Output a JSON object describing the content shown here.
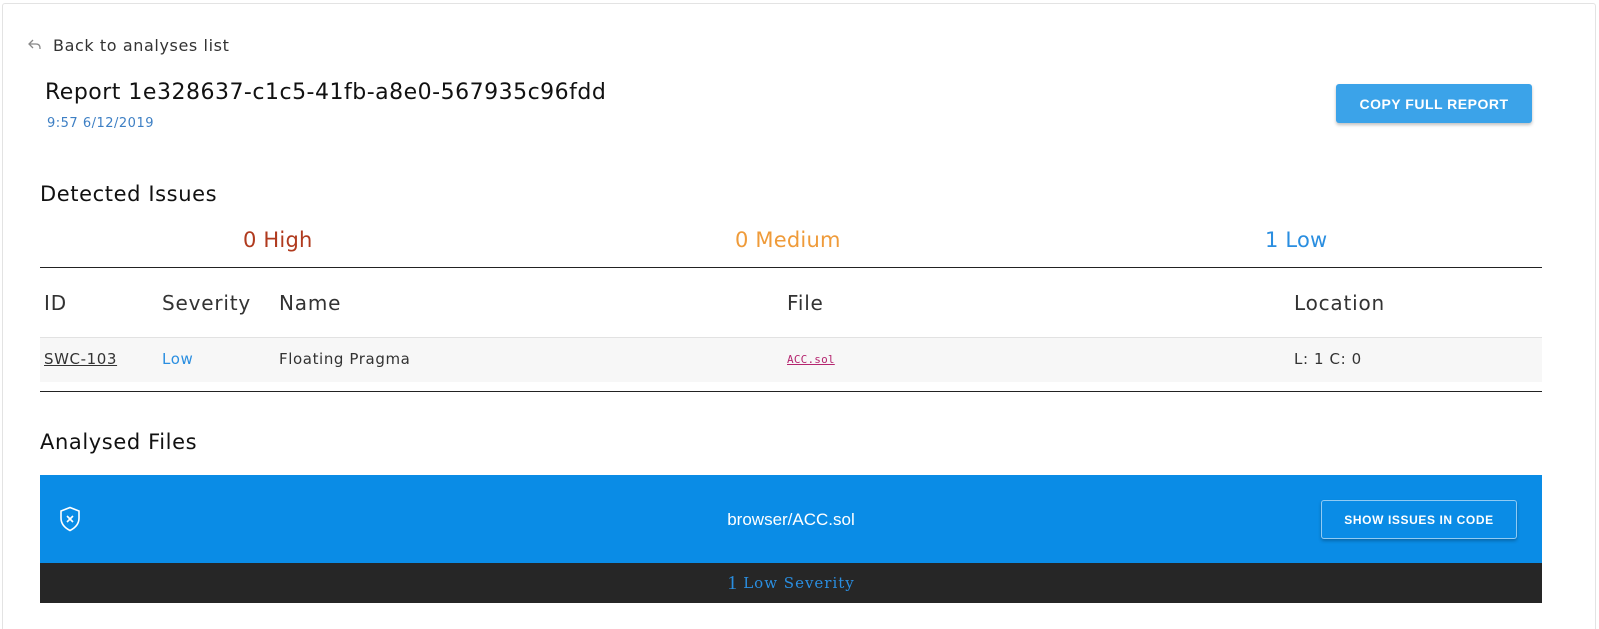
{
  "nav": {
    "back_label": "Back to analyses list",
    "back_icon": "reply-arrow-icon"
  },
  "report": {
    "title": "Report 1e328637-c1c5-41fb-a8e0-567935c96fdd",
    "date": "9:57 6/12/2019",
    "copy_button": "COPY FULL REPORT"
  },
  "detected": {
    "title": "Detected Issues",
    "counts": {
      "high": "0 High",
      "medium": "0 Medium",
      "low": "1 Low"
    },
    "columns": [
      "ID",
      "Severity",
      "Name",
      "File",
      "Location"
    ],
    "rows": [
      {
        "id": "SWC-103",
        "severity": "Low",
        "name": "Floating Pragma",
        "file": "ACC.sol",
        "location": "L: 1 C: 0"
      }
    ]
  },
  "analysed": {
    "title": "Analysed Files",
    "files": [
      {
        "name": "browser/ACC.sol",
        "icon": "shield-x-icon",
        "show_button": "SHOW ISSUES IN CODE",
        "severity_count": "1",
        "severity_label": "Low Severity"
      }
    ]
  },
  "colors": {
    "high": "#b03a1e",
    "medium": "#ef9b3a",
    "low": "#2a8ee0",
    "accent_button": "#3ba3e9",
    "file_bar": "#0a8ce6",
    "severity_bar": "#262626"
  }
}
